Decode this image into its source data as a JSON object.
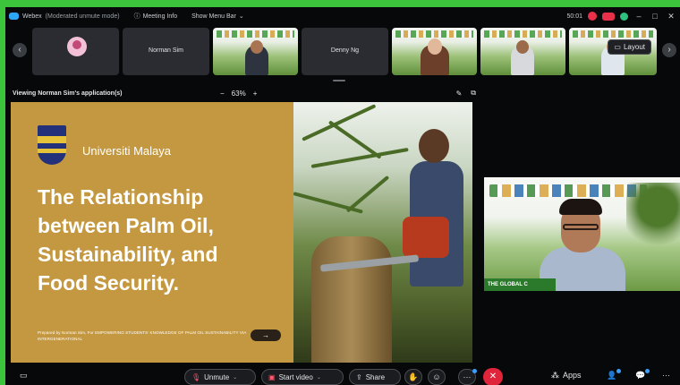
{
  "titlebar": {
    "app_name": "Webex",
    "mode": "(Moderated unmute mode)",
    "meeting_info": "Meeting Info",
    "show_menu_bar": "Show Menu Bar",
    "timer": "50:01"
  },
  "filmstrip": {
    "participants": [
      {
        "name": ""
      },
      {
        "name": "Norman Sim"
      },
      {
        "name": ""
      },
      {
        "name": "Denny Ng"
      },
      {
        "name": ""
      },
      {
        "name": ""
      },
      {
        "name": ""
      }
    ],
    "layout_label": "Layout"
  },
  "share": {
    "viewing_label": "Viewing Norman Sim's application(s)",
    "zoom_minus": "−",
    "zoom_level": "63%",
    "zoom_plus": "+"
  },
  "slide": {
    "university": "Universiti Malaya",
    "title_lines": [
      "The Relationship",
      "between Palm Oil,",
      "Sustainability, and",
      "Food Security."
    ],
    "prepared_by": "Prepared by Norman Sim, For EMPOWERING STUDENTS' KNOWLEDGE OF PALM OIL SUSTAINABILITY VIA INTERGENERATIONAL",
    "next_arrow": "→"
  },
  "speaker": {
    "footer_text": "THE GLOBAL C"
  },
  "controls": {
    "unmute_label": "Unmute",
    "start_video_label": "Start video",
    "share_label": "Share",
    "apps_label": "Apps",
    "more_label": "···"
  },
  "colors": {
    "slide_gold": "#c49840",
    "end_call_red": "#e0243c",
    "frame_green": "#3cc43c"
  }
}
